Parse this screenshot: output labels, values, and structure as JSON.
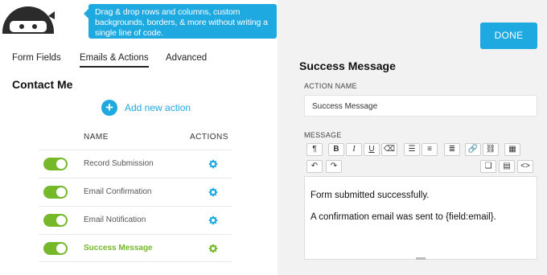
{
  "tooltip": {
    "text": "Drag & drop rows and columns, custom backgrounds, borders, & more without writing a single line of code."
  },
  "tabs": [
    {
      "label": "Form Fields"
    },
    {
      "label": "Emails & Actions",
      "active": true
    },
    {
      "label": "Advanced"
    }
  ],
  "form_title": "Contact Me",
  "add_action_label": "Add new action",
  "table": {
    "headers": [
      "NAME",
      "ACTIONS"
    ],
    "rows": [
      {
        "name": "Record Submission",
        "enabled": true
      },
      {
        "name": "Email Confirmation",
        "enabled": true
      },
      {
        "name": "Email Notification",
        "enabled": true
      },
      {
        "name": "Success Message",
        "enabled": true
      }
    ]
  },
  "done_label": "DONE",
  "panel": {
    "title": "Success Message",
    "action_name_label": "ACTION NAME",
    "action_name_value": "Success Message",
    "message_label": "MESSAGE",
    "toolbar": [
      "¶",
      "B",
      "I",
      "U",
      "eraser",
      "ol",
      "ul",
      "align",
      "link",
      "unlink",
      "table",
      "undo",
      "redo",
      "merge-tags",
      "html-table",
      "code"
    ],
    "message_lines": [
      "Form submitted successfully.",
      "A confirmation email was sent to {field:email}."
    ]
  },
  "colors": {
    "accent": "#1ea9e0",
    "toggle_on": "#75b82a",
    "right_panel_bg": "#f2f2f2"
  }
}
